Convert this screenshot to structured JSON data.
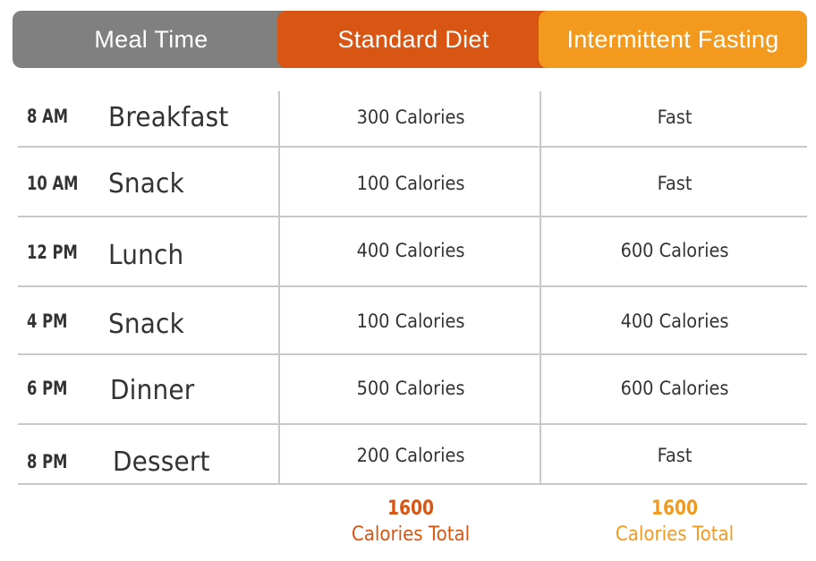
{
  "header": {
    "meal_time": "Meal Time",
    "standard_diet": "Standard Diet",
    "intermittent_fasting": "Intermittent Fasting"
  },
  "colors": {
    "meal_time_header": "#808080",
    "standard_diet": "#d95514",
    "intermittent_fasting": "#f39a1e",
    "text": "#333333",
    "grid": "#c8c8c8"
  },
  "rows": [
    {
      "time": "8 AM",
      "meal": "Breakfast",
      "standard": "300 Calories",
      "fasting": "Fast"
    },
    {
      "time": "10 AM",
      "meal": "Snack",
      "standard": "100 Calories",
      "fasting": "Fast"
    },
    {
      "time": "12 PM",
      "meal": "Lunch",
      "standard": "400 Calories",
      "fasting": "600 Calories"
    },
    {
      "time": "4 PM",
      "meal": "Snack",
      "standard": "100 Calories",
      "fasting": "400 Calories"
    },
    {
      "time": "6 PM",
      "meal": "Dinner",
      "standard": "500 Calories",
      "fasting": "600 Calories"
    },
    {
      "time": "8 PM",
      "meal": "Dessert",
      "standard": "200 Calories",
      "fasting": "Fast"
    }
  ],
  "totals": {
    "standard": {
      "value": "1600",
      "label": "Calories Total"
    },
    "fasting": {
      "value": "1600",
      "label": "Calories Total"
    }
  }
}
